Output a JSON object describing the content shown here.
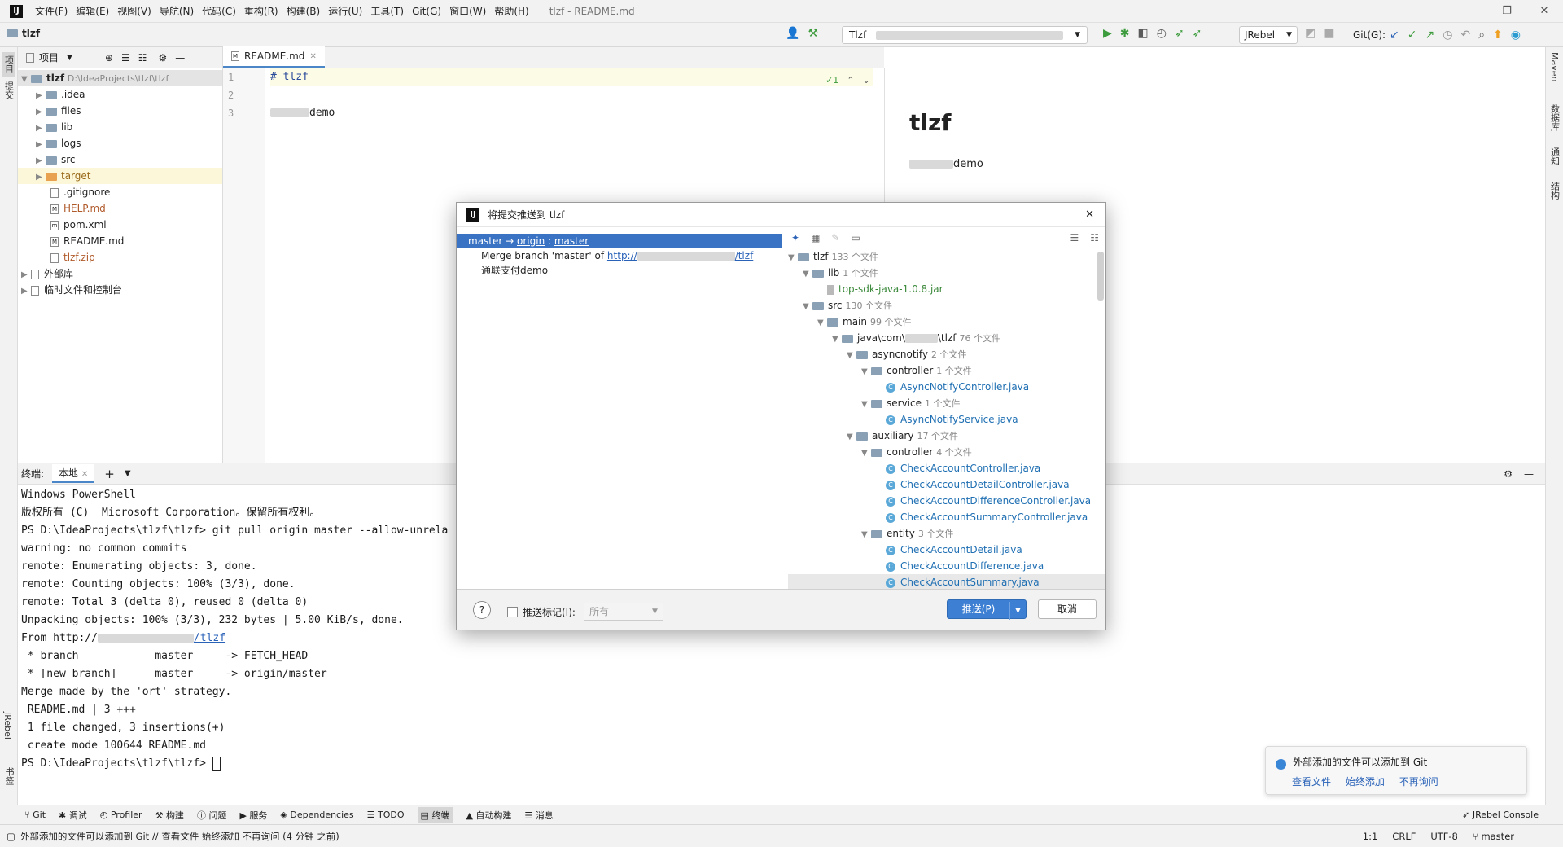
{
  "menubar": {
    "items": [
      "文件(F)",
      "编辑(E)",
      "视图(V)",
      "导航(N)",
      "代码(C)",
      "重构(R)",
      "构建(B)",
      "运行(U)",
      "工具(T)",
      "Git(G)",
      "窗口(W)",
      "帮助(H)"
    ],
    "window_title": "tlzf - README.md",
    "minimize": "—",
    "restore": "❐",
    "close": "✕"
  },
  "toolbar": {
    "project": "tlzf",
    "run_config": "Tlzf",
    "jrebel": "JRebel",
    "git_label": "Git(G):"
  },
  "left_tools": {
    "project": "项目",
    "commit": "提交",
    "jrebel": "JRebel",
    "bookmarks": "书签"
  },
  "right_tools": {
    "maven": "Maven",
    "database": "数据库",
    "notifications": "通知",
    "structure": "结构"
  },
  "project_panel": {
    "header": "项目",
    "root_name": "tlzf",
    "root_path": "D:\\IdeaProjects\\tlzf\\tlzf",
    "items": {
      "idea": ".idea",
      "files": "files",
      "lib": "lib",
      "logs": "logs",
      "src": "src",
      "target": "target",
      "gitignore": ".gitignore",
      "help": "HELP.md",
      "pom": "pom.xml",
      "readme": "README.md",
      "zip": "tlzf.zip",
      "ext_libs": "外部库",
      "scratches": "临时文件和控制台"
    }
  },
  "editor": {
    "tab": "README.md",
    "line_numbers": [
      "1",
      "2",
      "3"
    ],
    "line1": "# tlzf",
    "line3": "demo",
    "inspections": "✓1"
  },
  "preview": {
    "heading": "tlzf",
    "text": "demo"
  },
  "terminal": {
    "label": "终端:",
    "tab": "本地",
    "lines": [
      "Windows PowerShell",
      "版权所有 (C)  Microsoft Corporation。保留所有权利。",
      "PS D:\\IdeaProjects\\tlzf\\tlzf> git pull origin master --allow-unrela",
      "warning: no common commits",
      "remote: Enumerating objects: 3, done.",
      "remote: Counting objects: 100% (3/3), done.",
      "remote: Total 3 (delta 0), reused 0 (delta 0)",
      "Unpacking objects: 100% (3/3), 232 bytes | 5.00 KiB/s, done.",
      "From http://",
      "/tlzf",
      " * branch            master     -> FETCH_HEAD",
      " * [new branch]      master     -> origin/master",
      "Merge made by the 'ort' strategy.",
      " README.md | 3 +++",
      " 1 file changed, 3 insertions(+)",
      " create mode 100644 README.md",
      "PS D:\\IdeaProjects\\tlzf\\tlzf> "
    ]
  },
  "dialog": {
    "title": "将提交推送到 tlzf",
    "close": "✕",
    "branch_local": "master",
    "branch_arrow": " → ",
    "branch_remote": "origin",
    "branch_sep": " : ",
    "branch_target": "master",
    "commit1_prefix": "Merge branch 'master' of ",
    "commit1_link_a": "http://",
    "commit1_link_b": "/tlzf",
    "commit2": "通联支付demo",
    "tree": [
      {
        "name": "tlzf",
        "count": "133 个文件",
        "level": 0,
        "kind": "root"
      },
      {
        "name": "lib",
        "count": "1 个文件",
        "level": 1,
        "kind": "folder"
      },
      {
        "name": "top-sdk-java-1.0.8.jar",
        "count": "",
        "level": 2,
        "kind": "jar"
      },
      {
        "name": "src",
        "count": "130 个文件",
        "level": 1,
        "kind": "folder"
      },
      {
        "name": "main",
        "count": "99 个文件",
        "level": 2,
        "kind": "folder"
      },
      {
        "name": "java\\com\\",
        "name2": "\\tlzf",
        "count": "76 个文件",
        "level": 3,
        "kind": "folder"
      },
      {
        "name": "asyncnotify",
        "count": "2 个文件",
        "level": 4,
        "kind": "folder"
      },
      {
        "name": "controller",
        "count": "1 个文件",
        "level": 5,
        "kind": "folder"
      },
      {
        "name": "AsyncNotifyController.java",
        "count": "",
        "level": 6,
        "kind": "java"
      },
      {
        "name": "service",
        "count": "1 个文件",
        "level": 5,
        "kind": "folder"
      },
      {
        "name": "AsyncNotifyService.java",
        "count": "",
        "level": 6,
        "kind": "java"
      },
      {
        "name": "auxiliary",
        "count": "17 个文件",
        "level": 4,
        "kind": "folder"
      },
      {
        "name": "controller",
        "count": "4 个文件",
        "level": 5,
        "kind": "folder"
      },
      {
        "name": "CheckAccountController.java",
        "count": "",
        "level": 6,
        "kind": "java"
      },
      {
        "name": "CheckAccountDetailController.java",
        "count": "",
        "level": 6,
        "kind": "java"
      },
      {
        "name": "CheckAccountDifferenceController.java",
        "count": "",
        "level": 6,
        "kind": "java"
      },
      {
        "name": "CheckAccountSummaryController.java",
        "count": "",
        "level": 6,
        "kind": "java"
      },
      {
        "name": "entity",
        "count": "3 个文件",
        "level": 5,
        "kind": "folder"
      },
      {
        "name": "CheckAccountDetail.java",
        "count": "",
        "level": 6,
        "kind": "java"
      },
      {
        "name": "CheckAccountDifference.java",
        "count": "",
        "level": 6,
        "kind": "java"
      },
      {
        "name": "CheckAccountSummary.java",
        "count": "",
        "level": 6,
        "kind": "java"
      }
    ],
    "help": "?",
    "push_tags": "推送标记(I):",
    "tags_value": "所有",
    "push": "推送(P)",
    "cancel": "取消"
  },
  "bottom_tabs": [
    "Git",
    "调试",
    "Profiler",
    "构建",
    "问题",
    "服务",
    "Dependencies",
    "TODO",
    "终端",
    "自动构建",
    "消息"
  ],
  "jrebel_console": "JRebel Console",
  "notification": {
    "text": "外部添加的文件可以添加到 Git",
    "view": "查看文件",
    "always": "始终添加",
    "never": "不再询问"
  },
  "status": {
    "message": "外部添加的文件可以添加到 Git // 查看文件  始终添加  不再询问 (4 分钟 之前)",
    "position": "1:1",
    "line_sep": "CRLF",
    "encoding": "UTF-8",
    "branch": "master"
  },
  "colors": {
    "accent": "#3a73c4",
    "link": "#2a62b8",
    "green": "#3c9b3c"
  }
}
